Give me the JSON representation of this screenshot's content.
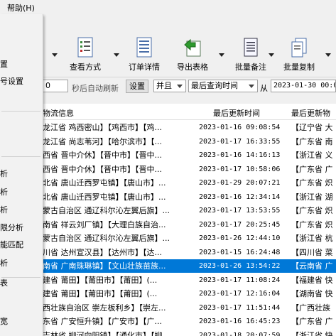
{
  "menubar": {
    "help": "帮助(H)"
  },
  "toolbar": {
    "view_mode": "查看方式",
    "order_detail": "订单详情",
    "export_table": "导出表格",
    "batch_note": "批量备注",
    "batch_copy": "批量复制"
  },
  "controls": {
    "refresh_seconds": "0",
    "refresh_label": "秒后自动刷新",
    "settings_button": "设置",
    "logic_select": "并且",
    "field_select": "最后查询时间",
    "from_label": "从",
    "from_date": "2023-01-30 00:0"
  },
  "table": {
    "columns": [
      "物流信息",
      "最后更新时间",
      "最后更新物"
    ],
    "rows": [
      {
        "info": "龙江省 鸡西密山】【鸡西市】【鸡...",
        "time": "2023-01-16 09:08:54",
        "last": "【辽宁省 大"
      },
      {
        "info": "龙江省 尚志苇河】【哈尔滨市】【...",
        "time": "2023-01-17 16:33:55",
        "last": "【广东省 南"
      },
      {
        "info": "西省 晋中介休】【晋中市】【晋中...",
        "time": "2023-01-16 14:16:13",
        "last": "【浙江省 义"
      },
      {
        "info": "西省 晋中介休】【晋中市】【晋中...",
        "time": "2023-01-17 10:58:06",
        "last": "【广东省 广"
      },
      {
        "info": "北省 唐山迁西罗屯镇】【唐山市】...",
        "time": "2023-01-29 20:07:21",
        "last": "【广东省 炽"
      },
      {
        "info": "北省 唐山迁西罗屯镇】【唐山市】...",
        "time": "2023-01-16 12:34:14",
        "last": "【浙江省 湖"
      },
      {
        "info": "蒙古自治区 通辽科尔沁左翼后旗】...",
        "time": "2023-01-17 13:53:55",
        "last": "【广东省 炽"
      },
      {
        "info": "南省 祥云刘厂镇】【大理白族自治...",
        "time": "2023-01-17 20:25:45",
        "last": "【广东省 炽"
      },
      {
        "info": "蒙古自治区 通辽科尔沁左翼后旗】...",
        "time": "2023-01-26 12:44:10",
        "last": "【浙江省 杭"
      },
      {
        "info": "川省 达州宣汉县】【达州市】【达...",
        "time": "2023-01-15 16:24:48",
        "last": "【四川省 菜"
      },
      {
        "info": "南省 广南珠琳镇】【文山壮族苗族...",
        "time": "2023-01-26 13:54:22",
        "last": "【云南省 广"
      },
      {
        "info": "建省 莆田】【莆田市】【莆田】(...",
        "time": "2023-01-17 11:08:24",
        "last": "【福建省 快"
      },
      {
        "info": "建省 莆田】【莆田市】【莆田】(...",
        "time": "2023-01-17 12:16:04",
        "last": "【湖南省 快"
      },
      {
        "info": "西壮族自治区 崇左板利乡】【崇左...",
        "time": "2023-01-17 11:51:44",
        "last": "【广西壮族"
      },
      {
        "info": "东省 广安恒升镇】【广安市】【广...",
        "time": "2023-01-16 16:45:23",
        "last": "【广东省 广"
      },
      {
        "info": "吉林省 柳河向阳镇】【通化市】【柳...",
        "time": "2023-01-18 20:07:59",
        "last": "【浙江省 快"
      }
    ]
  },
  "menu": {
    "items": [
      "置",
      "号设置",
      "析",
      "析",
      "析",
      "限分析",
      "能匹配",
      "析",
      "表",
      "宽"
    ]
  }
}
